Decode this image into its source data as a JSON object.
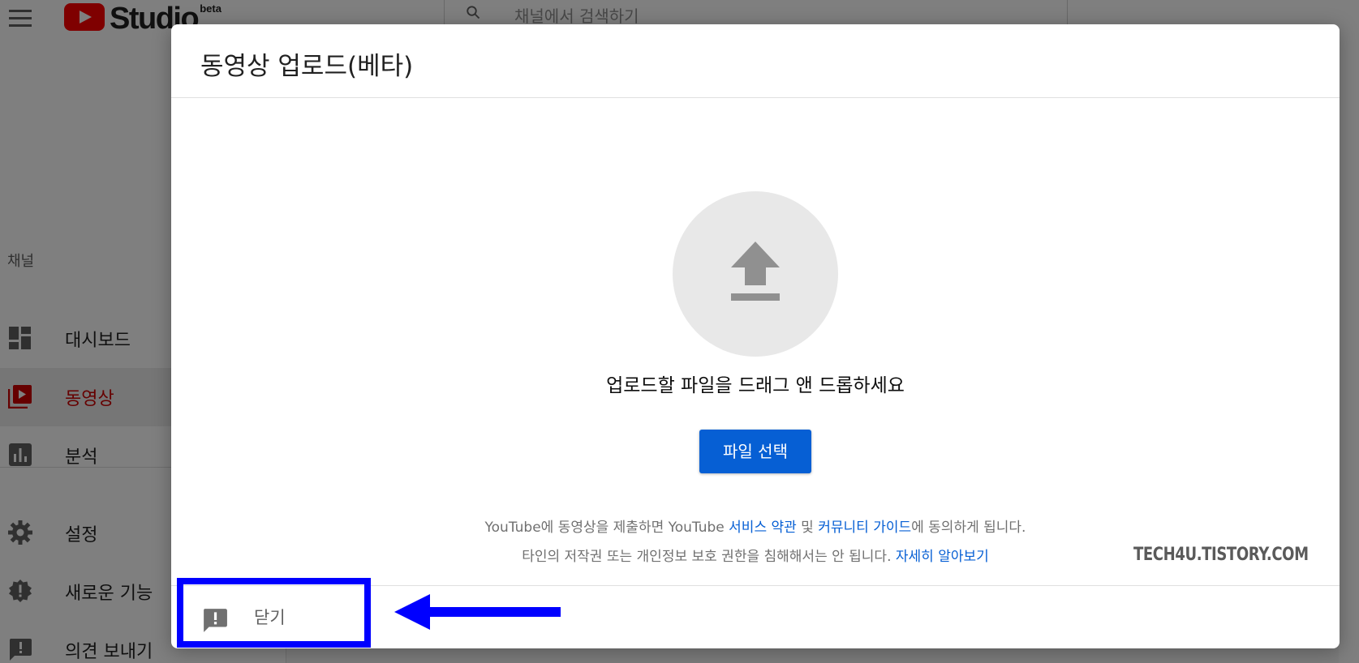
{
  "app": {
    "logo_text": "Studio",
    "logo_badge": "beta",
    "search_placeholder": "채널에서 검색하기"
  },
  "sidebar": {
    "section_label": "채널",
    "items": [
      {
        "label": "대시보드",
        "icon": "dashboard-icon",
        "active": false
      },
      {
        "label": "동영상",
        "icon": "video-library-icon",
        "active": true
      },
      {
        "label": "분석",
        "icon": "analytics-icon",
        "active": false
      },
      {
        "label": "설정",
        "icon": "gear-icon",
        "active": false
      },
      {
        "label": "새로운 기능",
        "icon": "whats-new-icon",
        "active": false
      },
      {
        "label": "의견 보내기",
        "icon": "feedback-icon",
        "active": false
      }
    ]
  },
  "dialog": {
    "title": "동영상 업로드(베타)",
    "upload_icon": "upload-arrow-icon",
    "drag_text": "업로드할 파일을 드래그 앤 드롭하세요",
    "select_button": "파일 선택",
    "legal": {
      "line1_pre": "YouTube에 동영상을 제출하면 YouTube ",
      "terms_link": "서비스 약관",
      "line1_mid": " 및 ",
      "guidelines_link": "커뮤니티 가이드",
      "line1_post": "에 동의하게 됩니다.",
      "line2_pre": "타인의 저작권 또는 개인정보 보호 권한을 침해해서는 안 됩니다. ",
      "learn_more_link": "자세히 알아보기"
    },
    "footer": {
      "feedback_icon": "feedback-icon",
      "close_label": "닫기"
    }
  },
  "watermark": "TECH4U.TISTORY.COM",
  "colors": {
    "brand_red": "#ff0000",
    "active_red": "#cc0000",
    "primary_blue": "#065fd4",
    "annotation_blue": "#0000ff",
    "scrim": "rgba(0,0,0,0.5)"
  }
}
